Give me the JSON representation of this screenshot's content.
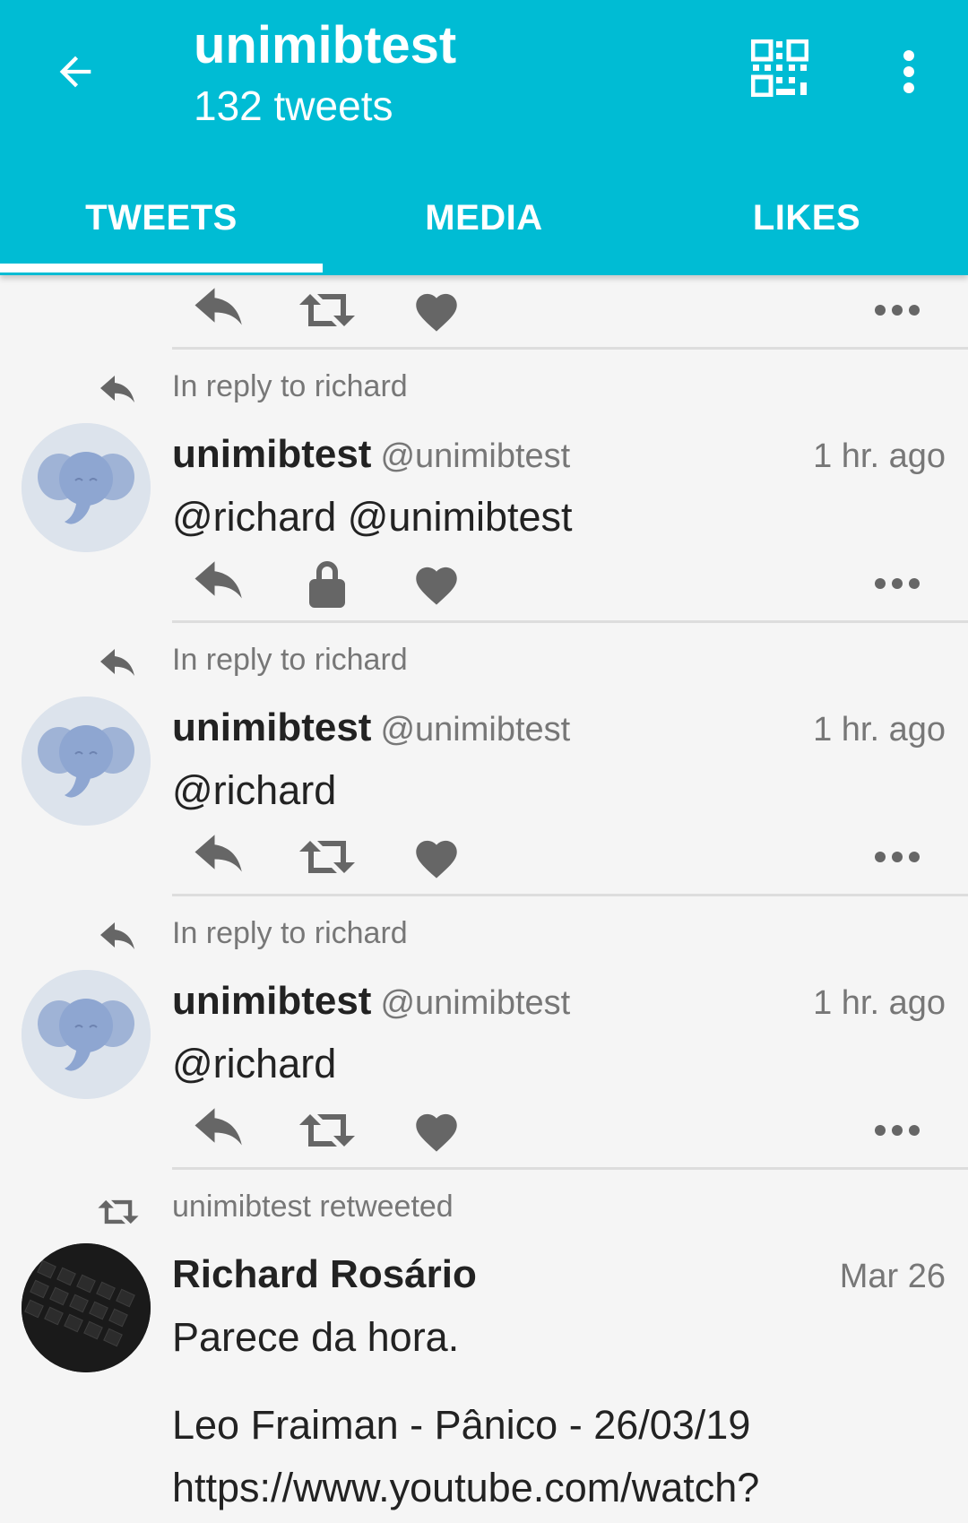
{
  "header": {
    "title": "unimibtest",
    "subtitle": "132 tweets"
  },
  "tabs": [
    {
      "label": "TWEETS"
    },
    {
      "label": "MEDIA"
    },
    {
      "label": "LIKES"
    }
  ],
  "tweets": [
    {
      "context": "In reply to richard",
      "name": "unimibtest",
      "handle": "@unimibtest",
      "time": "1 hr. ago",
      "text": "@richard @unimibtest"
    },
    {
      "context": "In reply to richard",
      "name": "unimibtest",
      "handle": "@unimibtest",
      "time": "1 hr. ago",
      "text": "@richard"
    },
    {
      "context": "In reply to richard",
      "name": "unimibtest",
      "handle": "@unimibtest",
      "time": "1 hr. ago",
      "text": "@richard"
    },
    {
      "context": "unimibtest retweeted",
      "name": "Richard Rosário",
      "handle": "",
      "time": "Mar 26",
      "text": "Parece da hora.",
      "text2": "Leo Fraiman - Pânico - 26/03/19",
      "text3": "https://www.youtube.com/watch?"
    }
  ],
  "colors": {
    "accent": "#00bcd4",
    "icon": "#666666",
    "text_secondary": "#777777"
  }
}
